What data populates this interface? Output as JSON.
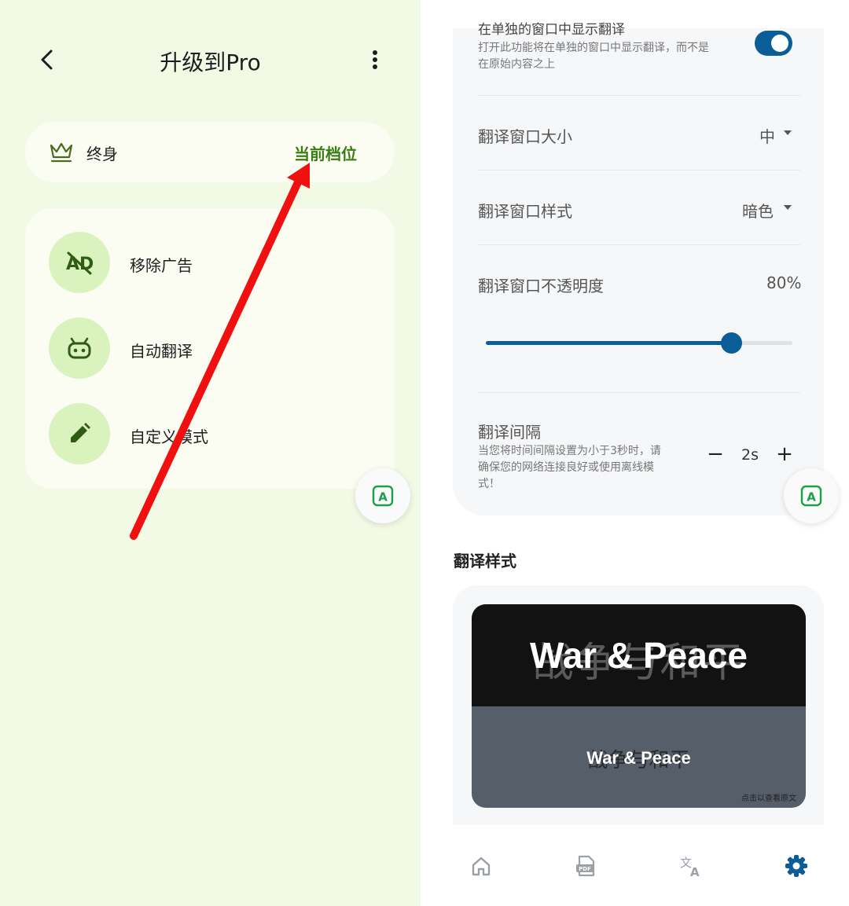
{
  "left": {
    "header": {
      "title": "升级到Pro"
    },
    "tier": {
      "name": "终身",
      "status": "当前档位"
    },
    "features": [
      {
        "label": "移除广告",
        "icon": "ad-off-icon"
      },
      {
        "label": "自动翻译",
        "icon": "robot-icon"
      },
      {
        "label": "自定义模式",
        "icon": "pencil-icon"
      }
    ],
    "fab": {
      "icon": "translate-a-icon",
      "letter": "A"
    }
  },
  "right": {
    "window_option": {
      "title": "在单独的窗口中显示翻译",
      "desc_line1": "打开此功能将在单独的窗口中显示翻译，而不是",
      "desc_line2": "在原始内容之上",
      "enabled": true
    },
    "size_row": {
      "label": "翻译窗口大小",
      "value": "中"
    },
    "style_row": {
      "label": "翻译窗口样式",
      "value": "暗色"
    },
    "opacity_row": {
      "label": "翻译窗口不透明度",
      "value": "80%",
      "level": 0.8
    },
    "interval_row": {
      "label": "翻译间隔",
      "desc_line1": "当您将时间间隔设置为小于3秒时，请",
      "desc_line2": "确保您的网络连接良好或使用离线模",
      "desc_line3": "式！",
      "value": "2s",
      "minus": "−",
      "plus": "+"
    },
    "fab": {
      "icon": "translate-a-icon",
      "letter": "A"
    },
    "translation_style": {
      "title": "翻译样式",
      "preview_text": "War & Peace",
      "preview_original": "战争与和平",
      "hint": "点击以查看原文"
    },
    "bottom_nav": [
      {
        "icon": "home-icon"
      },
      {
        "icon": "pdf-icon"
      },
      {
        "icon": "translate-icon"
      },
      {
        "icon": "gear-icon",
        "active": true
      }
    ],
    "colors": {
      "accent": "#0a5d96",
      "green": "#3a7d14"
    }
  }
}
